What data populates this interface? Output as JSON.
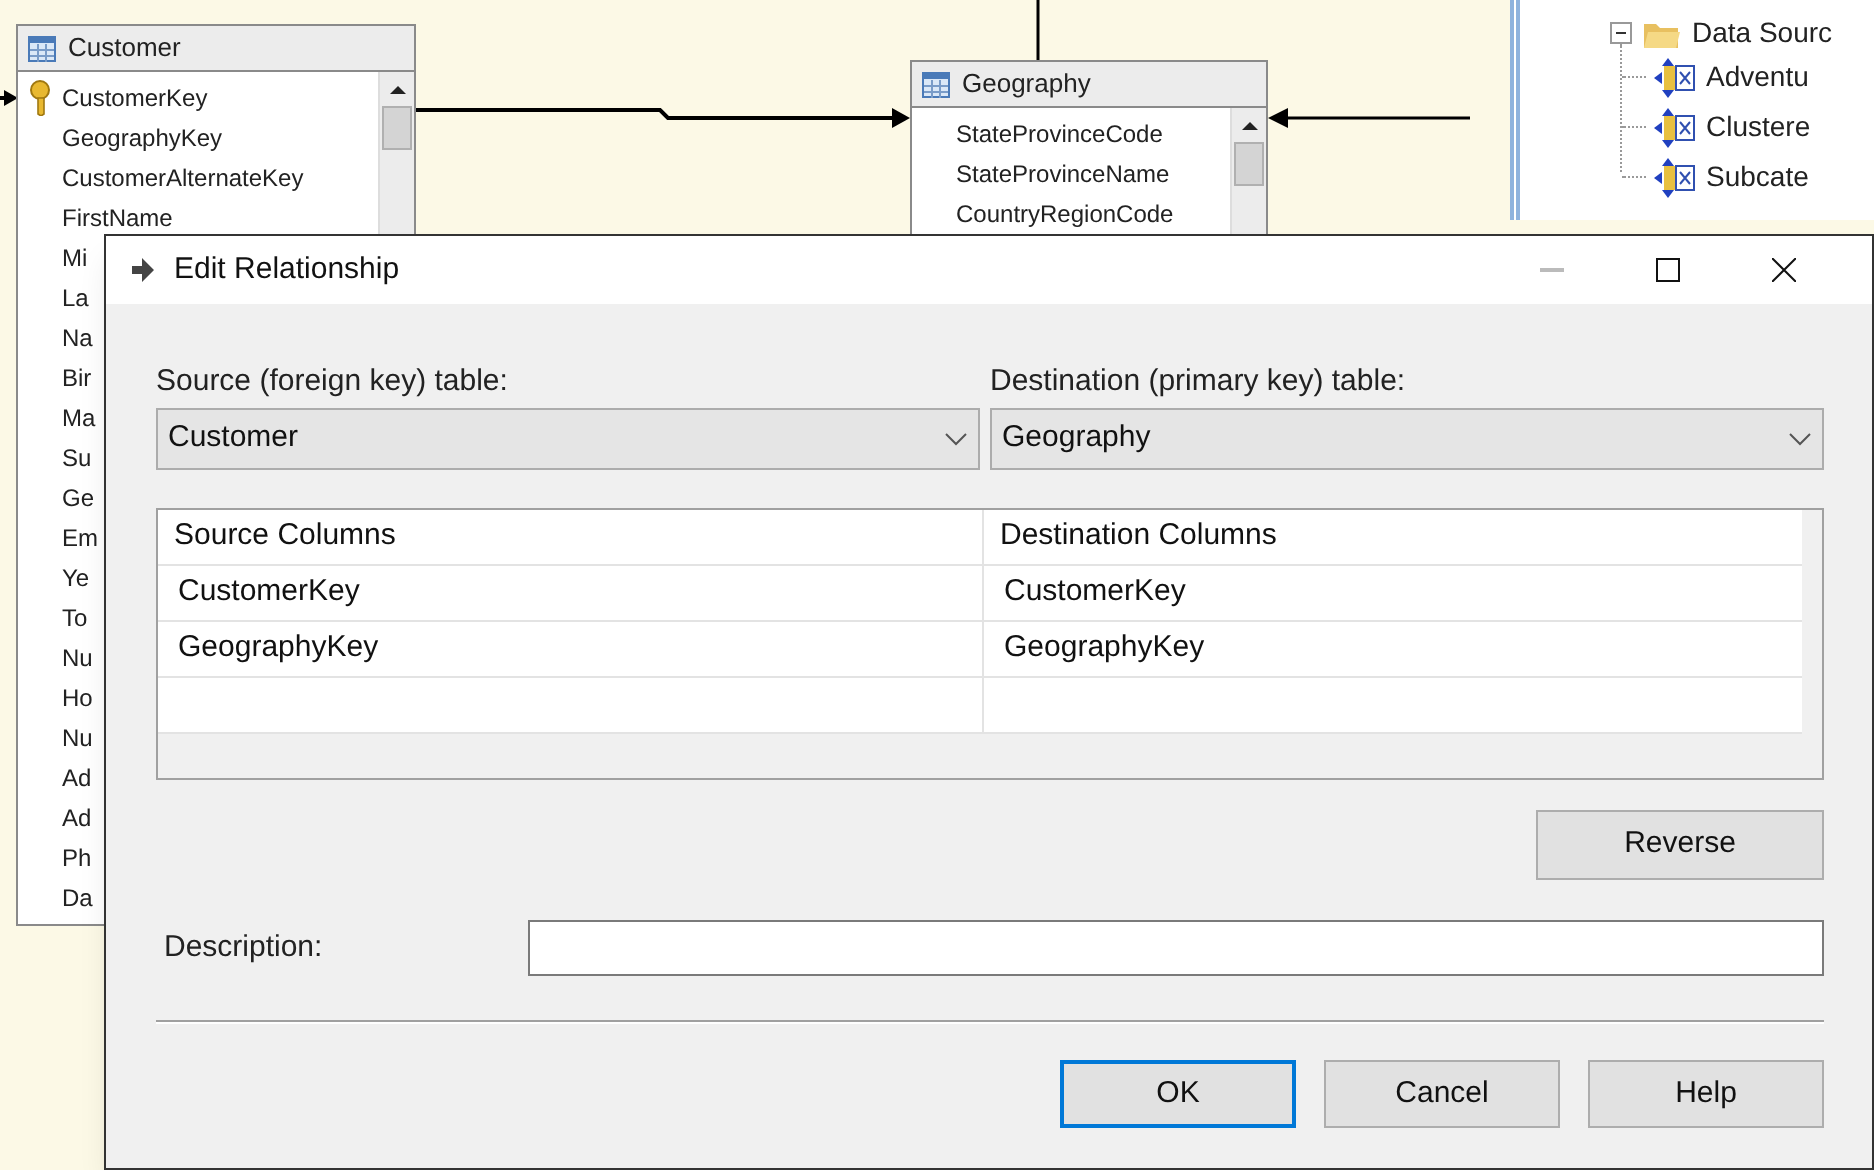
{
  "designer": {
    "tables": [
      {
        "title": "Customer",
        "columns": [
          {
            "name": "CustomerKey",
            "key": true
          },
          {
            "name": "GeographyKey",
            "key": false
          },
          {
            "name": "CustomerAlternateKey",
            "key": false
          },
          {
            "name": "FirstName",
            "key": false
          },
          {
            "name": "Mi",
            "key": false
          },
          {
            "name": "La",
            "key": false
          },
          {
            "name": "Na",
            "key": false
          },
          {
            "name": "Bir",
            "key": false
          },
          {
            "name": "Ma",
            "key": false
          },
          {
            "name": "Su",
            "key": false
          },
          {
            "name": "Ge",
            "key": false
          },
          {
            "name": "Em",
            "key": false
          },
          {
            "name": "Ye",
            "key": false
          },
          {
            "name": "To",
            "key": false
          },
          {
            "name": "Nu",
            "key": false
          },
          {
            "name": "Ho",
            "key": false
          },
          {
            "name": "Nu",
            "key": false
          },
          {
            "name": "Ad",
            "key": false
          },
          {
            "name": "Ad",
            "key": false
          },
          {
            "name": "Ph",
            "key": false
          },
          {
            "name": "Da",
            "key": false
          }
        ]
      },
      {
        "title": "Geography",
        "columns": [
          {
            "name": "StateProvinceCode",
            "key": false
          },
          {
            "name": "StateProvinceName",
            "key": false
          },
          {
            "name": "CountryRegionCode",
            "key": false
          }
        ]
      }
    ]
  },
  "solution_tree": {
    "label": "Data Sourc",
    "expanded": true,
    "children": [
      {
        "label": "Adventu"
      },
      {
        "label": "Clustere"
      },
      {
        "label": "Subcate"
      }
    ]
  },
  "dialog": {
    "title": "Edit Relationship",
    "source_label": "Source (foreign key) table:",
    "source_table": "Customer",
    "destination_label": "Destination (primary key) table:",
    "destination_table": "Geography",
    "grid": {
      "columns": [
        "Source Columns",
        "Destination Columns"
      ],
      "rows": [
        [
          "CustomerKey",
          "CustomerKey"
        ],
        [
          "GeographyKey",
          "GeographyKey"
        ]
      ]
    },
    "reverse_button": "Reverse",
    "description_label": "Description:",
    "buttons": [
      {
        "label": "OK",
        "default": true
      },
      {
        "label": "Cancel",
        "default": false
      },
      {
        "label": "Help",
        "default": false
      }
    ]
  }
}
